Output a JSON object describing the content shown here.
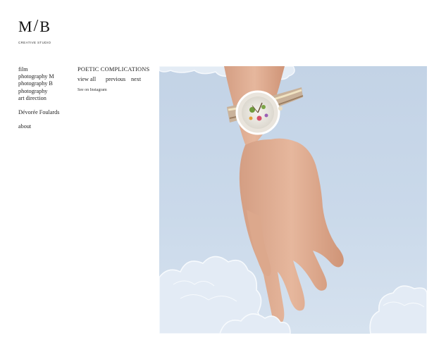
{
  "brand": {
    "mark_left": "M",
    "mark_right": "B",
    "tagline": "CREATIVE STUDIO"
  },
  "nav": {
    "items": [
      "film",
      "photography M",
      "photography B",
      "photography",
      "art direction"
    ],
    "secondary": "Dévorée Foulards",
    "about": "about"
  },
  "project": {
    "title": "POETIC COMPLICATIONS",
    "view_all": "view all",
    "previous": "previous",
    "next": "next",
    "instagram": "See on Instagram"
  },
  "hero": {
    "subject": "hand wearing jeweled floral watch against pale blue sky with embroidered clouds"
  }
}
